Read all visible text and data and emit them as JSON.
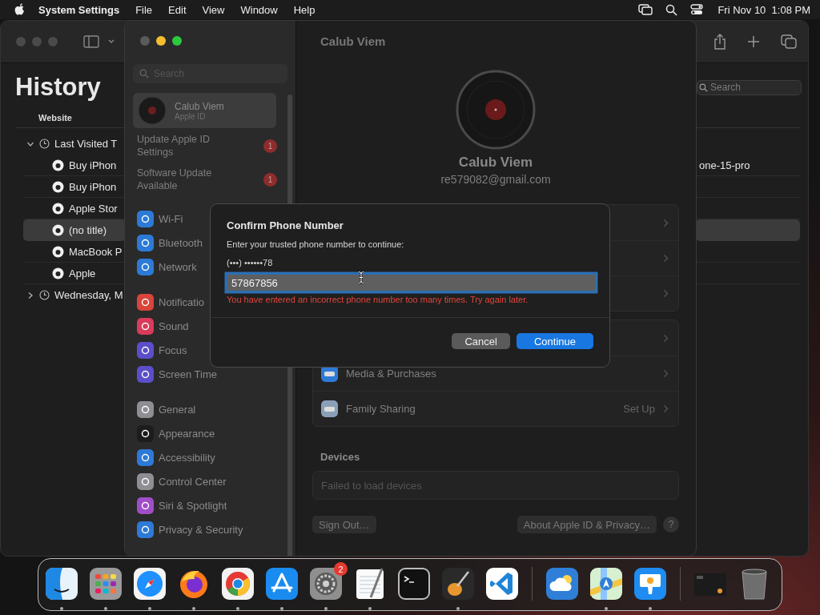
{
  "menu_bar": {
    "app": "System Settings",
    "menus": [
      "File",
      "Edit",
      "View",
      "Window",
      "Help"
    ],
    "clock": "Fri Nov 10  1:08 PM"
  },
  "safari": {
    "title": "History",
    "search": {
      "placeholder": "Search"
    },
    "column": "Website",
    "groups": [
      {
        "label": "Last Visited T",
        "expanded": true,
        "children": [
          {
            "title": "Buy iPhon",
            "address": "one-15-pro",
            "selected": false
          },
          {
            "title": "Buy iPhon",
            "selected": false
          },
          {
            "title": "Apple Stor",
            "selected": false
          },
          {
            "title": "(no title)",
            "selected": true
          },
          {
            "title": "MacBook P",
            "selected": false
          },
          {
            "title": "Apple",
            "selected": false
          }
        ]
      },
      {
        "label": "Wednesday, M",
        "expanded": false
      }
    ]
  },
  "settings": {
    "search": {
      "placeholder": "Search"
    },
    "account": {
      "name": "Calub Viem",
      "subtitle": "Apple ID",
      "selected": true
    },
    "alerts": [
      {
        "label": "Update Apple ID Settings",
        "badge": "1"
      },
      {
        "label": "Software Update Available",
        "badge": "1"
      }
    ],
    "sections": [
      [
        {
          "label": "Wi-Fi",
          "color": "#2d7ad6"
        },
        {
          "label": "Bluetooth",
          "color": "#2d7ad6"
        },
        {
          "label": "Network",
          "color": "#2d7ad6"
        }
      ],
      [
        {
          "label": "Notificatio",
          "color": "#d9443b"
        },
        {
          "label": "Sound",
          "color": "#d93b5a"
        },
        {
          "label": "Focus",
          "color": "#5b4fc9"
        },
        {
          "label": "Screen Time",
          "color": "#5b4fc9"
        }
      ],
      [
        {
          "label": "General",
          "color": "#8e8e93"
        },
        {
          "label": "Appearance",
          "color": "#1c1c1e"
        },
        {
          "label": "Accessibility",
          "color": "#2d7ad6"
        },
        {
          "label": "Control Center",
          "color": "#8e8e93"
        },
        {
          "label": "Siri & Spotlight",
          "color": "#a04ec8"
        },
        {
          "label": "Privacy & Security",
          "color": "#2d7ad6"
        }
      ]
    ],
    "title": "Calub Viem",
    "profile": {
      "name": "Calub Viem",
      "email": "re579082@gmail.com"
    },
    "groups": [
      [
        {
          "kind": "hidden"
        },
        {
          "kind": "hidden"
        },
        {
          "kind": "hidden"
        }
      ],
      [
        {
          "kind": "hidden"
        },
        {
          "kind": "item",
          "label": "Media & Purchases",
          "color": "#2d7ad6"
        },
        {
          "kind": "item",
          "label": "Family Sharing",
          "detail": "Set Up",
          "color": "#8aa0b8"
        }
      ]
    ],
    "devices": {
      "title": "Devices",
      "message": "Failed to load devices"
    },
    "footer": {
      "sign_out": "Sign Out…",
      "about": "About Apple ID & Privacy…",
      "help": "?"
    }
  },
  "dialog": {
    "title": "Confirm Phone Number",
    "prompt": "Enter your trusted phone number to continue:",
    "masked_number": "(•••) ••••••78",
    "input": {
      "value": "57867856",
      "focused": true
    },
    "error": "You have entered an incorrect phone number too many times. Try again later.",
    "buttons": [
      {
        "label": "Cancel",
        "primary": false
      },
      {
        "label": "Continue",
        "primary": true
      }
    ]
  },
  "dock": {
    "items": [
      {
        "kind": "finder",
        "running": true
      },
      {
        "kind": "launchpad",
        "running": true
      },
      {
        "kind": "safari",
        "running": true
      },
      {
        "kind": "firefox",
        "running": true
      },
      {
        "kind": "chrome",
        "running": true
      },
      {
        "kind": "appstore",
        "running": true
      },
      {
        "kind": "settings",
        "running": true,
        "badge": "2"
      },
      {
        "kind": "textedit",
        "running": true
      },
      {
        "kind": "terminal",
        "running": false
      },
      {
        "kind": "garageband",
        "running": true
      },
      {
        "kind": "vscode",
        "running": false
      },
      {
        "kind": "separator"
      },
      {
        "kind": "weather",
        "running": false
      },
      {
        "kind": "maps",
        "running": true
      },
      {
        "kind": "keynote",
        "running": true
      },
      {
        "kind": "separator"
      },
      {
        "kind": "window",
        "running": false
      },
      {
        "kind": "trash",
        "running": false
      }
    ]
  }
}
